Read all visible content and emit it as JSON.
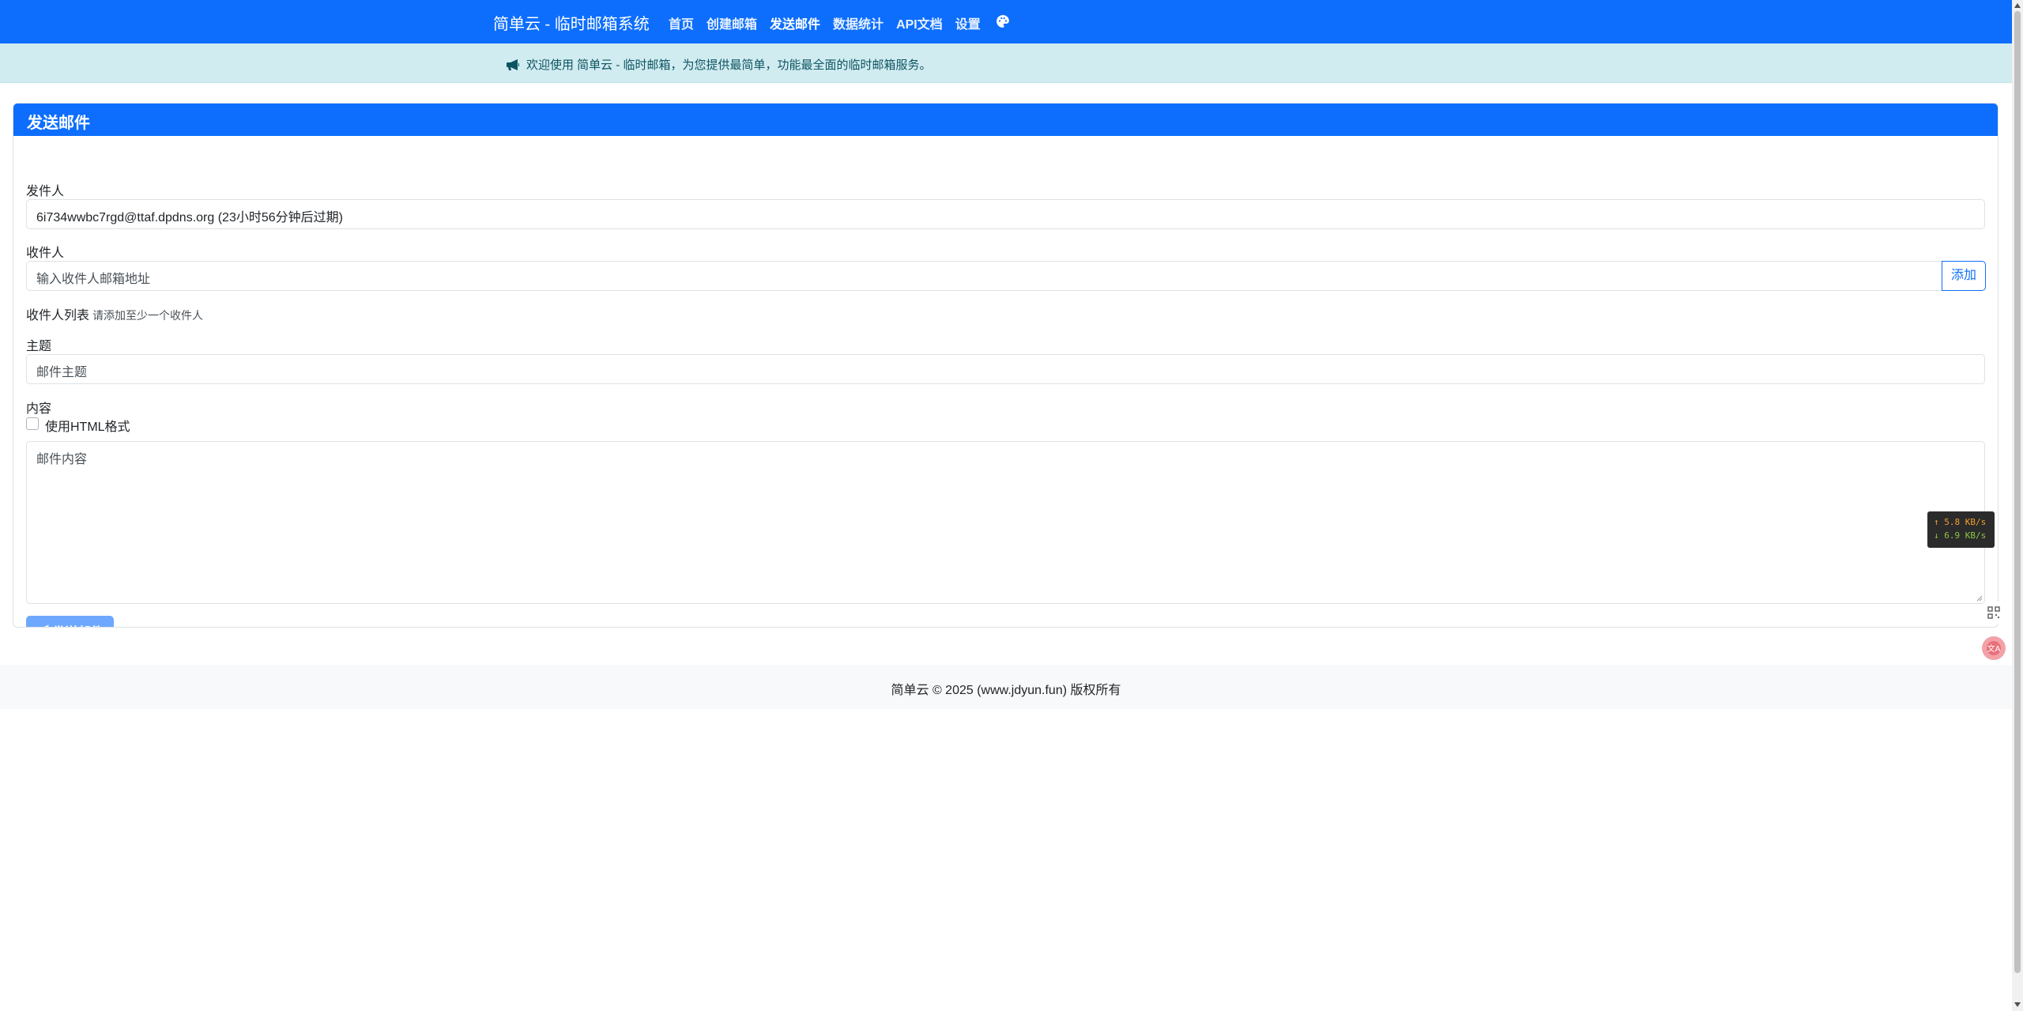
{
  "navbar": {
    "brand": "简单云 - 临时邮箱系统",
    "links": [
      "首页",
      "创建邮箱",
      "发送邮件",
      "数据统计",
      "API文档",
      "设置"
    ],
    "active_index": 2,
    "palette_icon": "palette-icon",
    "bg_color": "#0d6efd"
  },
  "alert": {
    "icon": "megaphone-icon",
    "text": "欢迎使用 简单云 - 临时邮箱，为您提供最简单，功能最全面的临时邮箱服务。"
  },
  "card": {
    "title": "发送邮件",
    "sender_label": "发件人",
    "sender_value": "6i734wwbc7rgd@ttaf.dpdns.org (23小时56分钟后过期)",
    "recipient_label": "收件人",
    "recipient_placeholder": "输入收件人邮箱地址",
    "add_button": "添加",
    "recipient_list_label": "收件人列表",
    "recipient_list_hint": "请添加至少一个收件人",
    "subject_label": "主题",
    "subject_placeholder": "邮件主题",
    "content_label": "内容",
    "html_checkbox_label": "使用HTML格式",
    "html_checked": false,
    "content_placeholder": "邮件内容",
    "send_button": "发送邮件",
    "send_icon": "paper-plane-icon"
  },
  "footer": {
    "text": "简单云 © 2025 (www.jdyun.fun) 版权所有"
  },
  "speed_widget": {
    "up": "↑ 5.8 KB/s",
    "down": "↓ 6.9 KB/s"
  },
  "colors": {
    "primary": "#0d6efd",
    "send_button_disabled": "#6ea8fe",
    "alert_bg": "#d1ecf1",
    "alert_text": "#0c5460"
  }
}
